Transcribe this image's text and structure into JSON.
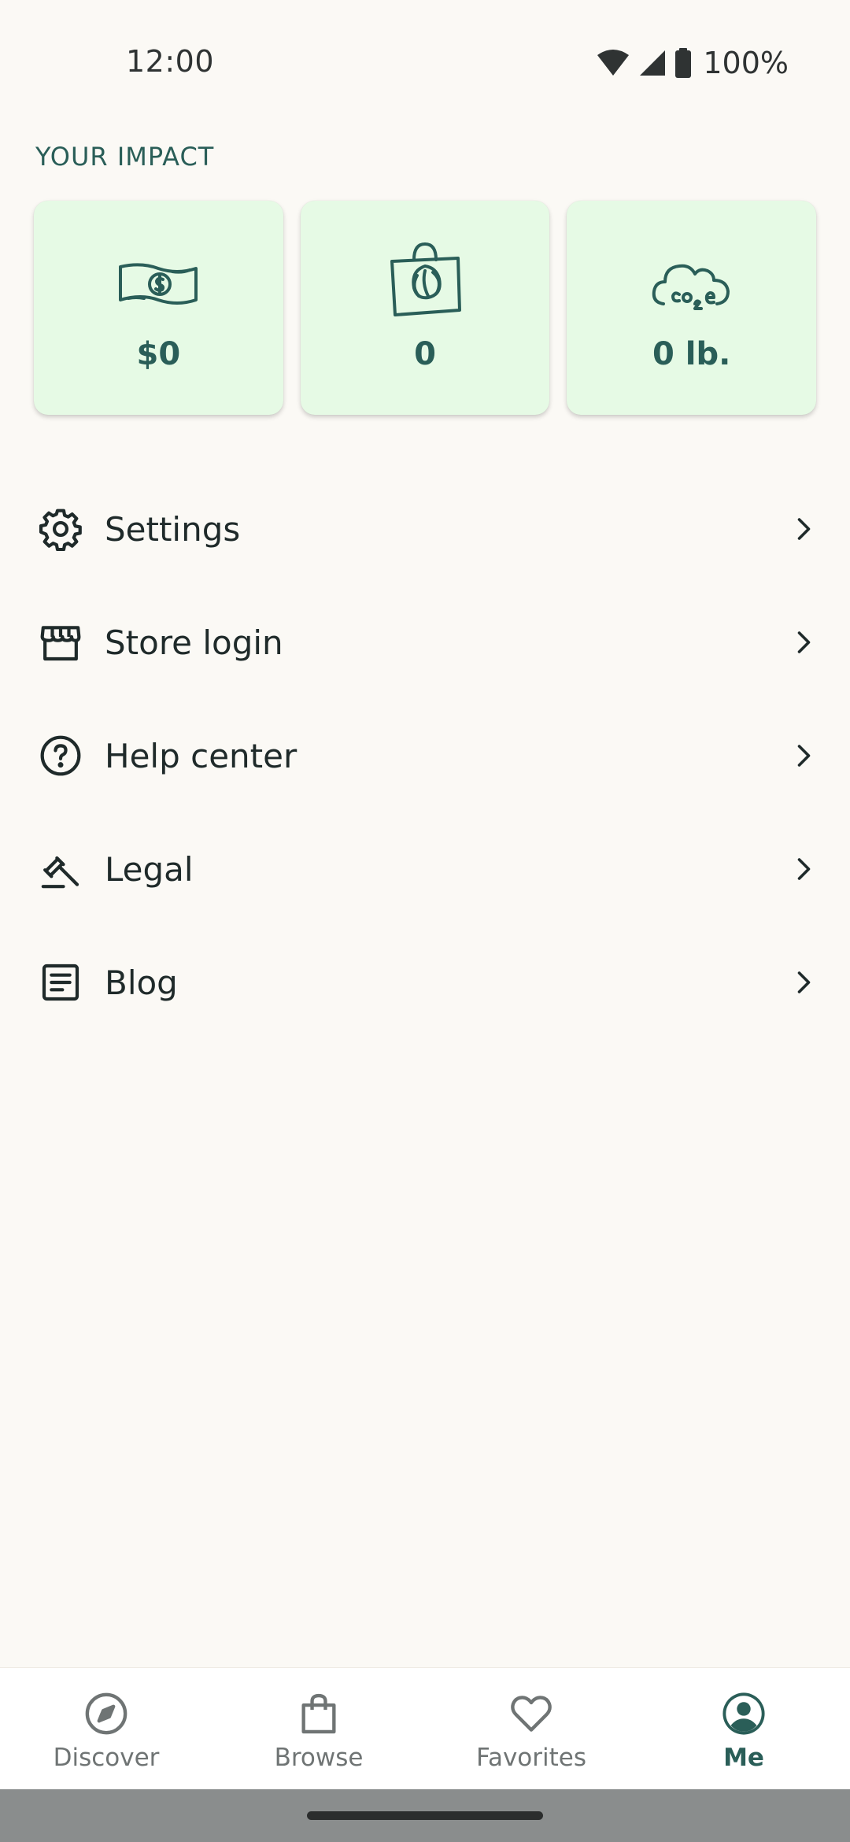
{
  "status_bar": {
    "time": "12:00",
    "battery": "100%",
    "icons": [
      "wifi-icon",
      "signal-icon",
      "battery-icon"
    ]
  },
  "impact": {
    "title": "YOUR IMPACT",
    "cards": [
      {
        "icon": "money-icon",
        "value": "$0"
      },
      {
        "icon": "bag-icon",
        "value": "0"
      },
      {
        "icon": "co2e-cloud-icon",
        "value": "0 lb."
      }
    ]
  },
  "menu": {
    "items": [
      {
        "icon": "gear-icon",
        "label": "Settings"
      },
      {
        "icon": "store-icon",
        "label": "Store login"
      },
      {
        "icon": "help-icon",
        "label": "Help center"
      },
      {
        "icon": "gavel-icon",
        "label": "Legal"
      },
      {
        "icon": "article-icon",
        "label": "Blog"
      }
    ]
  },
  "bottom_nav": {
    "items": [
      {
        "icon": "compass-icon",
        "label": "Discover",
        "active": false
      },
      {
        "icon": "bag-icon",
        "label": "Browse",
        "active": false
      },
      {
        "icon": "heart-icon",
        "label": "Favorites",
        "active": false
      },
      {
        "icon": "profile-icon",
        "label": "Me",
        "active": true
      }
    ]
  },
  "colors": {
    "background": "#FBF9F5",
    "brand": "#2A5E58",
    "card": "#E6FAE5"
  }
}
